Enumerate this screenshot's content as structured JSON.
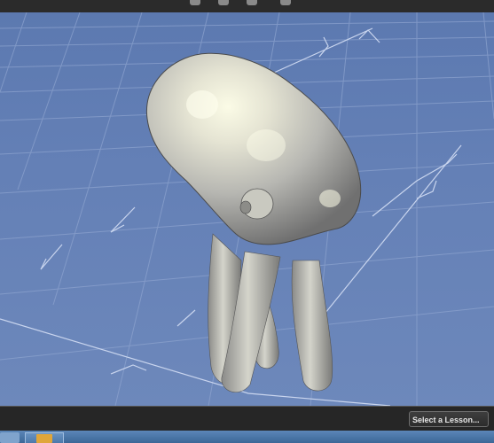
{
  "app": {
    "toolbar_icons": [
      "rotate-icon",
      "pan-icon",
      "zoom-icon",
      "frame-icon"
    ],
    "viewport": {
      "subject": "octopus-model",
      "background_color": "#6482b7",
      "grid_color": "#8ea4cf"
    },
    "lesson_selector": {
      "label": "Select a Lesson..."
    },
    "taskbar": {
      "items": [
        "start-button",
        "folder-icon"
      ]
    }
  }
}
